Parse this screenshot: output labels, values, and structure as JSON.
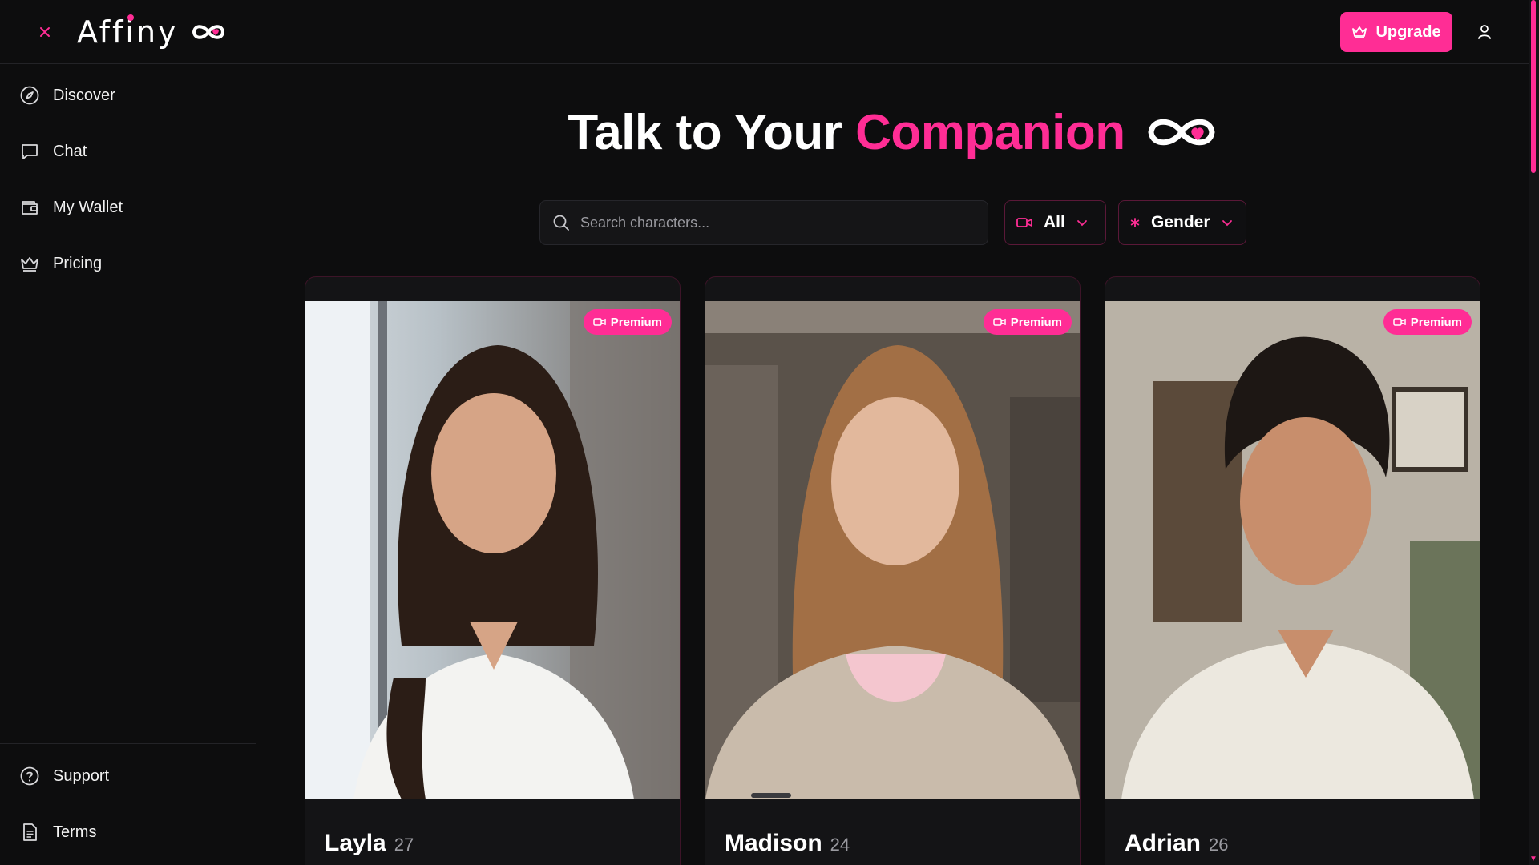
{
  "header": {
    "logo_text": "Affiny",
    "upgrade_label": "Upgrade"
  },
  "sidebar": {
    "items": [
      {
        "label": "Discover",
        "icon": "compass-icon"
      },
      {
        "label": "Chat",
        "icon": "chat-bubble-icon"
      },
      {
        "label": "My Wallet",
        "icon": "wallet-icon"
      },
      {
        "label": "Pricing",
        "icon": "crown-icon"
      }
    ],
    "bottom_items": [
      {
        "label": "Support",
        "icon": "help-circle-icon"
      },
      {
        "label": "Terms",
        "icon": "document-icon"
      }
    ]
  },
  "hero": {
    "title_prefix": "Talk to Your",
    "title_accent": "Companion"
  },
  "search": {
    "placeholder": "Search characters..."
  },
  "filters": {
    "type_value": "All",
    "gender_value": "Gender"
  },
  "cards": [
    {
      "name": "Layla",
      "age": "27",
      "badge": "Premium"
    },
    {
      "name": "Madison",
      "age": "24",
      "badge": "Premium"
    },
    {
      "name": "Adrian",
      "age": "26",
      "badge": "Premium"
    }
  ],
  "colors": {
    "accent": "#ff2d95",
    "background": "#0d0d0e",
    "card_border": "#3d1428"
  }
}
